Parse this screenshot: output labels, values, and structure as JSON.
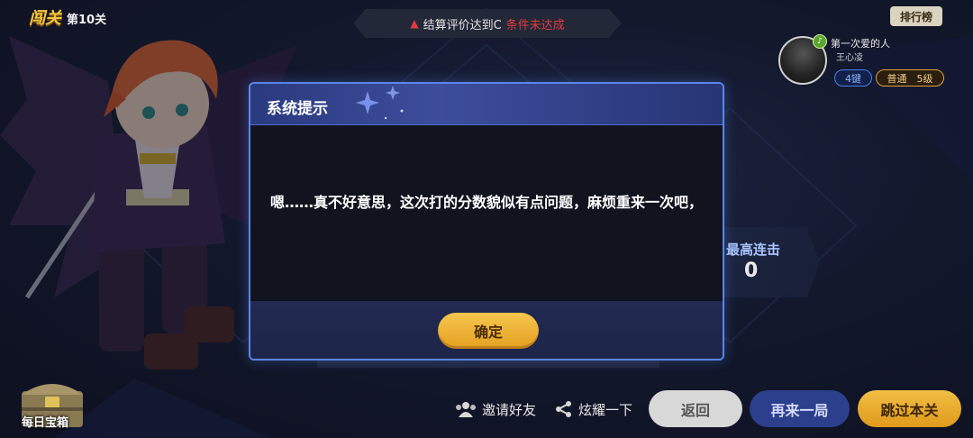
{
  "header": {
    "mode_title": "闯关",
    "level_label": "第10关"
  },
  "condition": {
    "text": "结算评价达到C",
    "status": "条件未达成"
  },
  "ranking": {
    "button_label": "排行榜",
    "player_name": "第一次爱的人",
    "player_subtitle": "王心凌",
    "key_label": "4键",
    "difficulty_label": "普通",
    "level_label": "5级"
  },
  "stats": {
    "combo_label": "最高连击",
    "combo_value": "0"
  },
  "dialog": {
    "title": "系统提示",
    "message": "嗯……真不好意思，这次打的分数貌似有点问题，麻烦重来一次吧，",
    "confirm_label": "确定"
  },
  "bottom": {
    "chest_label": "每日宝箱",
    "invite_label": "邀请好友",
    "share_label": "炫耀一下",
    "back_label": "返回",
    "retry_label": "再来一局",
    "skip_label": "跳过本关"
  },
  "colors": {
    "accent_gold": "#f0b432",
    "dialog_border": "#5a86e6",
    "warning_red": "#e03a3a"
  }
}
